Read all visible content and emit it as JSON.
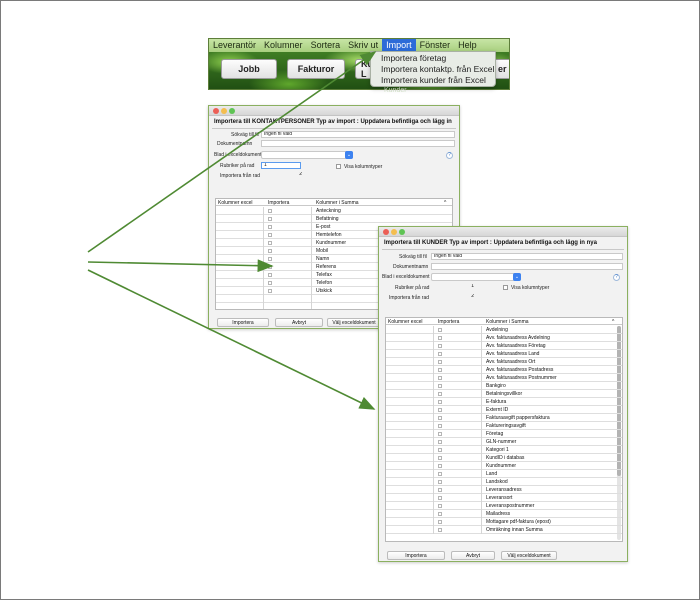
{
  "menubar": {
    "items": [
      "Leverantör",
      "Kolumner",
      "Sortera",
      "Skriv ut",
      "Import",
      "Fönster",
      "Help"
    ],
    "active": "Import"
  },
  "toolbar": {
    "buttons": [
      "Jobb",
      "Fakturor",
      "Kund & L"
    ],
    "partial_right": "er",
    "partial_below": "Kunder"
  },
  "import_menu": {
    "items": [
      "Importera företag",
      "Importera kontaktp. från Excel",
      "Importera kunder från Excel"
    ]
  },
  "dialog_contacts": {
    "title": "Importera till KONTAKTPERSONER Typ av import : Uppdatera befintliga och lägg in",
    "path_label": "Sökväg till fil",
    "path_value": "Ingen fil vald",
    "docname_label": "Dokumentnamn",
    "docname_value": "",
    "sheet_label": "Blad i exceldokument",
    "header_rows_label": "Rubriker på rad",
    "header_rows_value": "1",
    "import_from_label": "Importera från rad",
    "import_from_value": "2",
    "show_types_label": "Visa kolumntyper",
    "help": "?",
    "columns": [
      "Kolumner excel",
      "Importera",
      "Kolumner i Summa"
    ],
    "rows": [
      "Anteckning",
      "Befattning",
      "E-post",
      "Hemtelefon",
      "Kundnummer",
      "Mobil",
      "Namn",
      "Referens",
      "Telefax",
      "Telefon",
      "Utskick"
    ],
    "buttons": [
      "Importera",
      "Avbryt",
      "Välj exceldokument"
    ]
  },
  "dialog_customers": {
    "title": "Importera till KUNDER Typ av import : Uppdatera befintliga och lägg in nya",
    "path_label": "Sökväg till fil",
    "path_value": "Ingen fil vald",
    "docname_label": "Dokumentnamn",
    "docname_value": "",
    "sheet_label": "Blad i exceldokument",
    "header_rows_label": "Rubriker på rad",
    "header_rows_value": "1",
    "import_from_label": "Importera från rad",
    "import_from_value": "2",
    "show_types_label": "Visa kolumntyper",
    "help": "?",
    "columns": [
      "Kolumner excel",
      "Importera",
      "Kolumner i Summa"
    ],
    "rows": [
      "Avdelning",
      "Avv. fakturaadress Avdelning",
      "Avv. fakturaadress Företag",
      "Avv. fakturaadress Land",
      "Avv. fakturaadress Ort",
      "Avv. fakturaadress Postadress",
      "Avv. fakturaadress Postnummer",
      "Bankgiro",
      "Betalningsvillkor",
      "E-faktura",
      "Externt ID",
      "Fakturaavgift pappersfaktura",
      "Faktureringsavgift",
      "Företag",
      "GLN-nummer",
      "Kategori 1",
      "KundID i databas",
      "Kundnummer",
      "Land",
      "Landskod",
      "Leveransadress",
      "Leveransort",
      "Leveranspostnummer",
      "Mailadress",
      "Mottagare pdf-faktura (epost)",
      "Omräkning innan Summa"
    ],
    "buttons": [
      "Importera",
      "Avbryt",
      "Välj exceldokument"
    ]
  },
  "colors": {
    "menubar": "#b7dc8f",
    "active_menu": "#2d6bd8",
    "arrow": "#4f8a33",
    "dialog_border": "#8bb060",
    "select_accent": "#3d82f0"
  }
}
